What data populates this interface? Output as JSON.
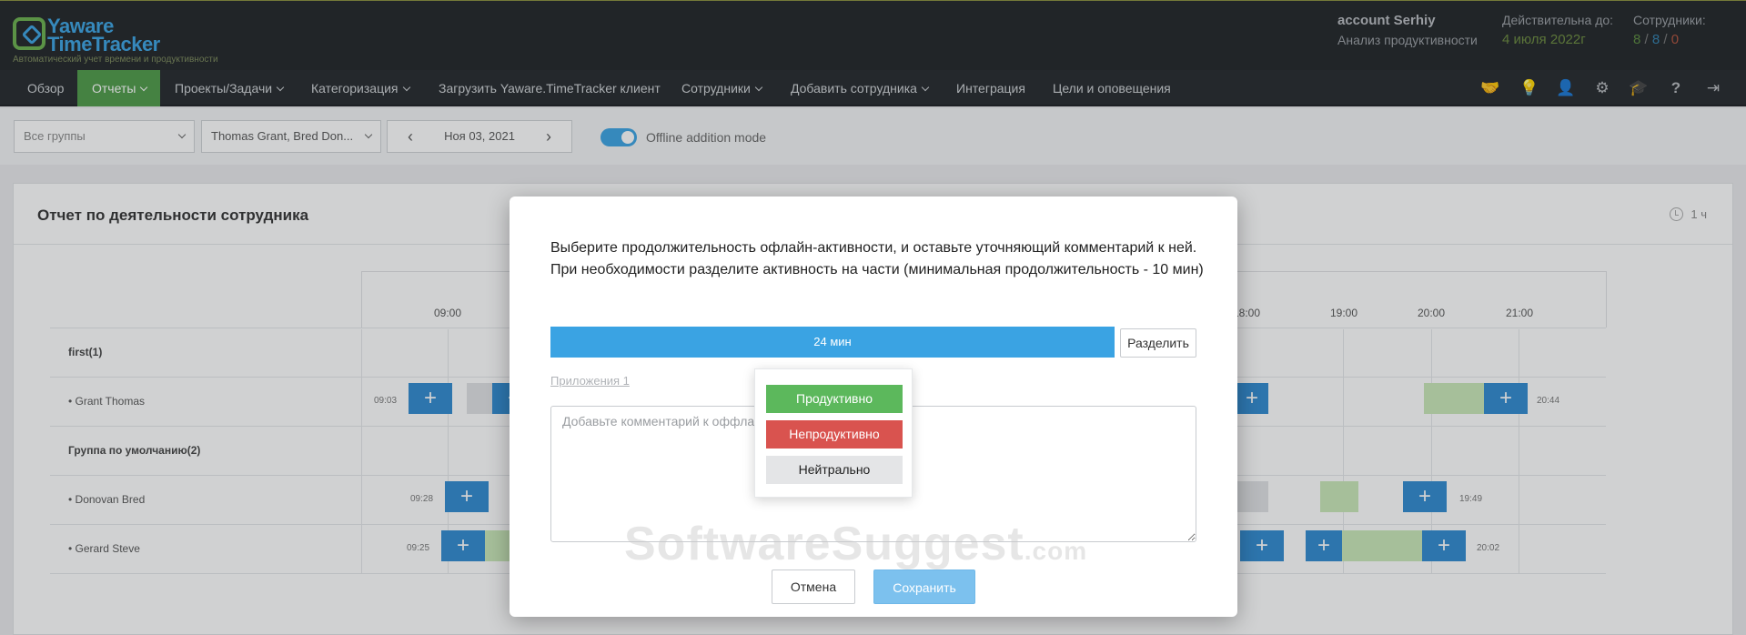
{
  "header": {
    "logo_line1": "Yaware",
    "logo_line2": "TimeTracker",
    "logo_subtitle": "Автоматический учет времени и продуктивности",
    "account_name": "account Serhiy",
    "account_sub": "Анализ продуктивности",
    "valid_label": "Действительна до:",
    "valid_date": "4 июля 2022г",
    "employees_label": "Сотрудники:",
    "employees_counts": [
      "8",
      "8",
      "0"
    ]
  },
  "nav": {
    "items": [
      {
        "label": "Обзор",
        "dropdown": false
      },
      {
        "label": "Отчеты",
        "dropdown": true,
        "active": true
      },
      {
        "label": "Проекты/Задачи",
        "dropdown": true
      },
      {
        "label": "Категоризация",
        "dropdown": true
      },
      {
        "label": "Загрузить Yaware.TimeTracker клиент",
        "dropdown": false
      },
      {
        "label": "Сотрудники",
        "dropdown": true
      },
      {
        "label": "Добавить сотрудника",
        "dropdown": true
      },
      {
        "label": "Интеграция",
        "dropdown": false
      },
      {
        "label": "Цели и оповещения",
        "dropdown": false
      }
    ],
    "icons": [
      "handshake-icon",
      "lightbulb-icon",
      "user-icon",
      "gear-icon",
      "graduation-cap-icon",
      "help-icon",
      "logout-icon"
    ]
  },
  "filters": {
    "group_select": "Все группы",
    "employee_select": "Thomas Grant, Bred Don...",
    "date": "Ноя 03, 2021",
    "offline_mode_label": "Offline addition mode",
    "offline_mode_on": true
  },
  "report": {
    "title": "Отчет по деятельности сотрудника",
    "duration": "1 ч",
    "hours": [
      "09:00",
      "18:00",
      "19:00",
      "20:00",
      "21:00"
    ],
    "rows": [
      {
        "label": "first(1)",
        "group": true
      },
      {
        "label": "• Grant Thomas",
        "start": "09:03",
        "end": "20:44"
      },
      {
        "label": "Группа по умолчанию(2)",
        "group": true
      },
      {
        "label": "• Donovan Bred",
        "start": "09:28",
        "end": "19:49"
      },
      {
        "label": "• Gerard Steve",
        "start": "09:25",
        "end": "20:02"
      }
    ]
  },
  "modal": {
    "text": "Выберите продолжительность офлайн-активности, и оставьте уточняющий комментарий к ней. При необходимости разделите активность на части (минимальная продолжительность - 10 мин)",
    "duration_bar": "24 мин",
    "split_button": "Разделить",
    "apps_link": "Приложения 1",
    "comment_placeholder": "Добавьте комментарий к оффлайн-активности",
    "cancel_button": "Отмена",
    "save_button": "Сохранить",
    "watermark_main": "SoftwareSuggest",
    "watermark_tld": ".com",
    "popup": {
      "productive": "Продуктивно",
      "unproductive": "Непродуктивно",
      "neutral": "Нейтрально"
    }
  },
  "colors": {
    "accent": "#3aa3e3",
    "nav_active": "#4e9a47",
    "productive": "#5cb85c",
    "unproductive": "#d9534f"
  }
}
